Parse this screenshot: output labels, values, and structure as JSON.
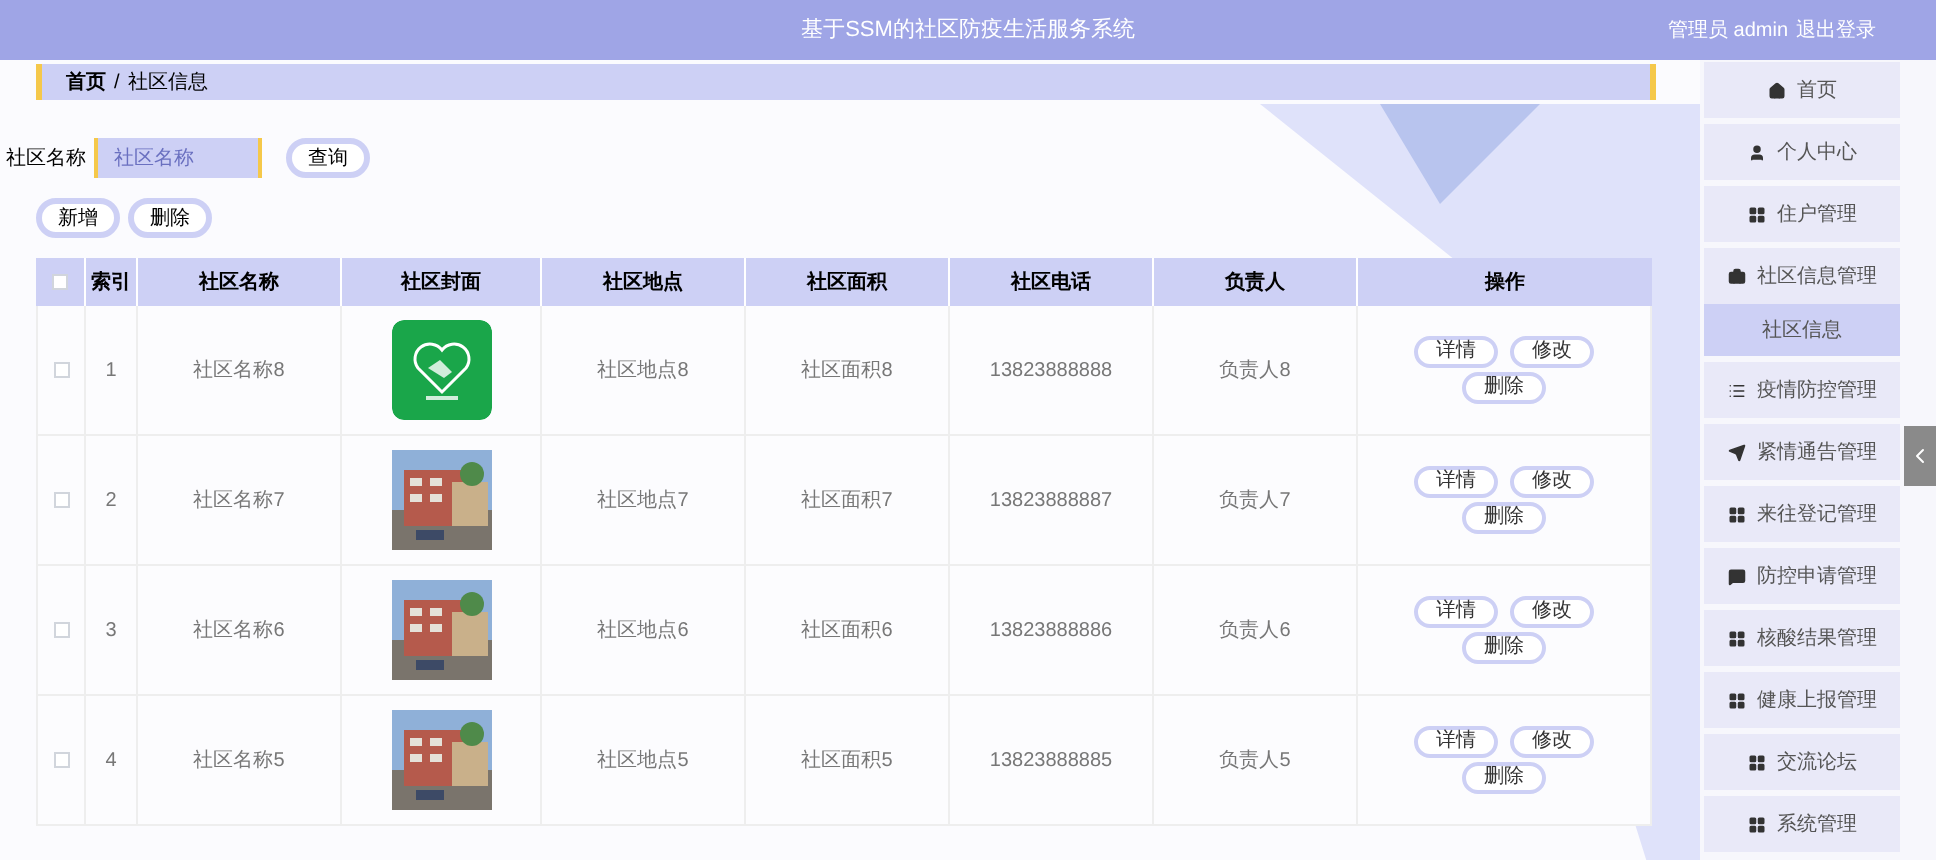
{
  "header": {
    "title": "基于SSM的社区防疫生活服务系统",
    "user": "管理员 admin",
    "logout": "退出登录"
  },
  "breadcrumb": {
    "items": [
      "首页",
      "社区信息"
    ],
    "separator": "/"
  },
  "search": {
    "label": "社区名称",
    "placeholder": "社区名称",
    "button": "查询"
  },
  "actions": [
    "新增",
    "删除"
  ],
  "table": {
    "columns": [
      "索引",
      "社区名称",
      "社区封面",
      "社区地点",
      "社区面积",
      "社区电话",
      "负责人",
      "操作"
    ],
    "all_checked": false,
    "rows": [
      {
        "checked": false,
        "index": "1",
        "name": "社区名称8",
        "cover": {
          "kind": "logo"
        },
        "location": "社区地点8",
        "area": "社区面积8",
        "phone": "13823888888",
        "person": "负责人8",
        "ops": [
          "详情",
          "修改",
          "删除"
        ]
      },
      {
        "checked": false,
        "index": "2",
        "name": "社区名称7",
        "cover": {
          "kind": "picture"
        },
        "location": "社区地点7",
        "area": "社区面积7",
        "phone": "13823888887",
        "person": "负责人7",
        "ops": [
          "详情",
          "修改",
          "删除"
        ]
      },
      {
        "checked": false,
        "index": "3",
        "name": "社区名称6",
        "cover": {
          "kind": "picture"
        },
        "location": "社区地点6",
        "area": "社区面积6",
        "phone": "13823888886",
        "person": "负责人6",
        "ops": [
          "详情",
          "修改",
          "删除"
        ]
      },
      {
        "checked": false,
        "index": "4",
        "name": "社区名称5",
        "cover": {
          "kind": "picture"
        },
        "location": "社区地点5",
        "area": "社区面积5",
        "phone": "13823888885",
        "person": "负责人5",
        "ops": [
          "详情",
          "修改",
          "删除"
        ]
      }
    ]
  },
  "sidebar": {
    "items": [
      {
        "label": "首页",
        "selected": false
      },
      {
        "label": "个人中心",
        "selected": false
      },
      {
        "label": "住户管理",
        "selected": false
      },
      {
        "label": "社区信息管理",
        "selected": false,
        "children": [
          {
            "label": "社区信息",
            "selected": true
          }
        ]
      },
      {
        "label": "疫情防控管理",
        "selected": false
      },
      {
        "label": "紧情通告管理",
        "selected": false
      },
      {
        "label": "来往登记管理",
        "selected": false
      },
      {
        "label": "防控申请管理",
        "selected": false
      },
      {
        "label": "核酸结果管理",
        "selected": false
      },
      {
        "label": "健康上报管理",
        "selected": false
      },
      {
        "label": "交流论坛",
        "selected": false
      },
      {
        "label": "系统管理",
        "selected": false
      }
    ]
  }
}
